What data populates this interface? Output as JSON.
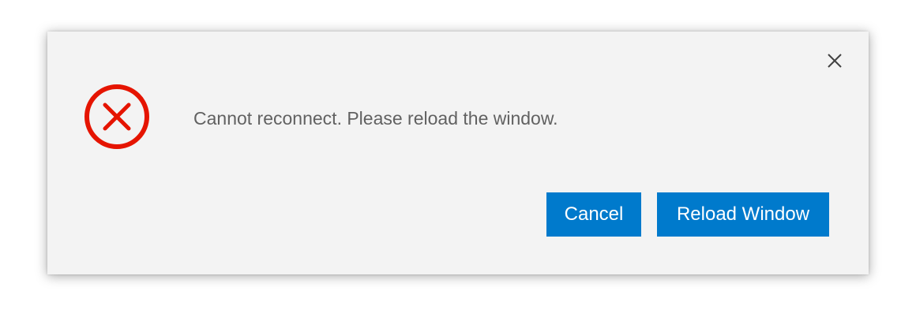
{
  "dialog": {
    "message": "Cannot reconnect. Please reload the window.",
    "icon": "error-circle-x-icon",
    "close_icon": "close-icon",
    "buttons": {
      "cancel_label": "Cancel",
      "reload_label": "Reload Window"
    }
  },
  "colors": {
    "dialog_background": "#f3f3f3",
    "error": "#e51400",
    "button_background": "#007acc",
    "button_text": "#ffffff",
    "message_text": "#616161"
  }
}
